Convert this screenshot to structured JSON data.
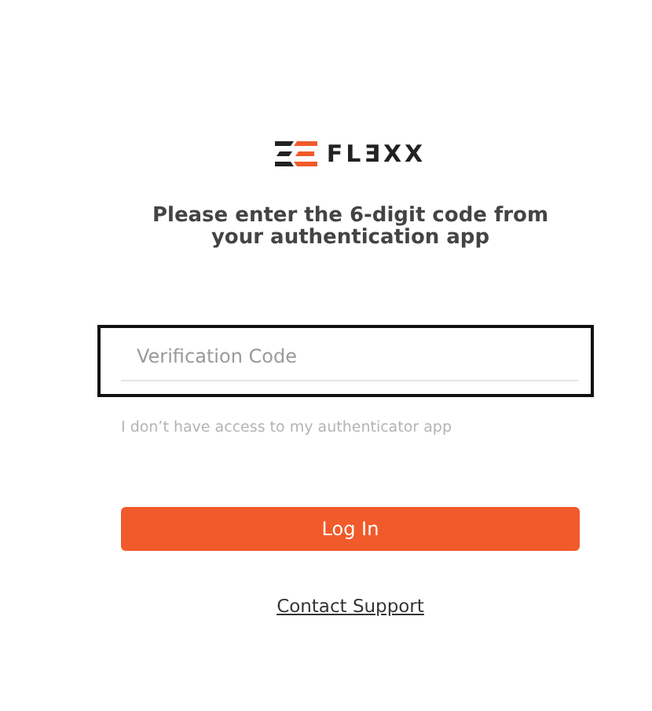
{
  "logo": {
    "text": "FLƎXX"
  },
  "heading": "Please enter the 6-digit code from your authentication app",
  "code_field": {
    "placeholder": "Verification Code",
    "focused": true
  },
  "no_access_link": "I don’t have access to my authenticator app",
  "login_button": "Log In",
  "support_link": "Contact Support"
}
